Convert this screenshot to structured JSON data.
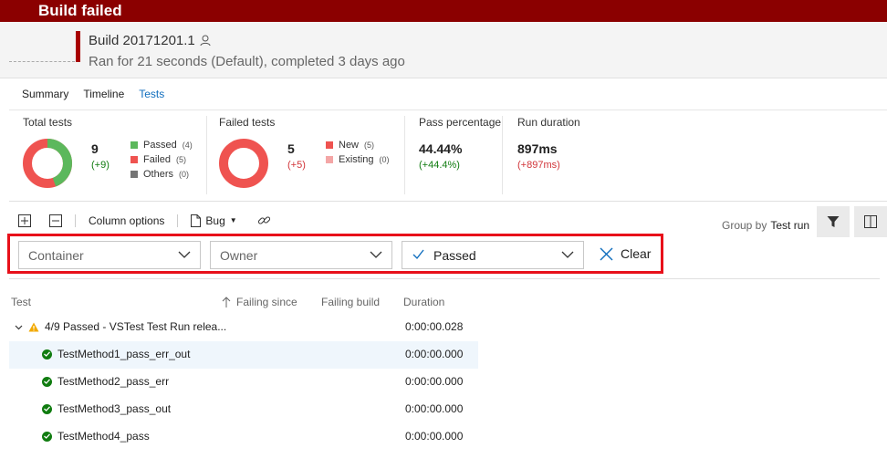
{
  "banner": {
    "title": "Build failed",
    "color": "#8b0000"
  },
  "header": {
    "build_name": "Build 20171201.1",
    "subtitle": "Ran for 21 seconds (Default), completed 3 days ago"
  },
  "tabs": [
    {
      "label": "Summary",
      "active": false
    },
    {
      "label": "Timeline",
      "active": false
    },
    {
      "label": "Tests",
      "active": true
    }
  ],
  "metrics": {
    "total": {
      "label": "Total tests",
      "value": "9",
      "delta": "(+9)",
      "legend": [
        {
          "label": "Passed",
          "count": "(4)",
          "color": "#5cb85c"
        },
        {
          "label": "Failed",
          "count": "(5)",
          "color": "#ef5350"
        },
        {
          "label": "Others",
          "count": "(0)",
          "color": "#757575"
        }
      ],
      "passed_fraction": 0.4444
    },
    "failed": {
      "label": "Failed tests",
      "value": "5",
      "delta": "(+5)",
      "legend": [
        {
          "label": "New",
          "count": "(5)",
          "color": "#ef5350"
        },
        {
          "label": "Existing",
          "count": "(0)",
          "color": "#f4a6a6"
        }
      ]
    },
    "pass_pct": {
      "label": "Pass percentage",
      "value": "44.44%",
      "delta": "(+44.4%)"
    },
    "duration": {
      "label": "Run duration",
      "value": "897ms",
      "delta": "(+897ms)"
    }
  },
  "toolbar": {
    "expand_icon": "expand-all-icon",
    "collapse_icon": "collapse-all-icon",
    "column_options": "Column options",
    "bug": "Bug",
    "link_icon": "link-icon",
    "group_by_label": "Group by",
    "group_by_value": "Test run"
  },
  "filters": {
    "container_placeholder": "Container",
    "owner_placeholder": "Owner",
    "outcome_value": "Passed",
    "clear_label": "Clear"
  },
  "columns": {
    "test": "Test",
    "failing_since": "Failing since",
    "failing_build": "Failing build",
    "duration": "Duration"
  },
  "group_row": {
    "label": "4/9 Passed - VSTest Test Run relea...",
    "duration": "0:00:00.028"
  },
  "tests": [
    {
      "name": "TestMethod1_pass_err_out",
      "duration": "0:00:00.000"
    },
    {
      "name": "TestMethod2_pass_err",
      "duration": "0:00:00.000"
    },
    {
      "name": "TestMethod3_pass_out",
      "duration": "0:00:00.000"
    },
    {
      "name": "TestMethod4_pass",
      "duration": "0:00:00.000"
    }
  ]
}
